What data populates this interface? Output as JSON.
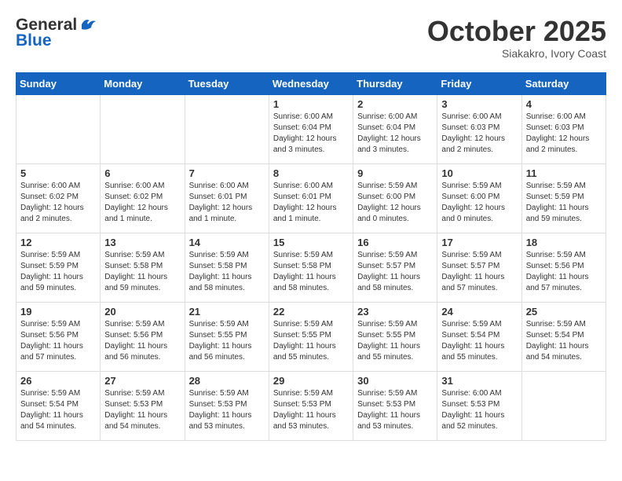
{
  "header": {
    "logo_general": "General",
    "logo_blue": "Blue",
    "month": "October 2025",
    "location": "Siakakro, Ivory Coast"
  },
  "days_of_week": [
    "Sunday",
    "Monday",
    "Tuesday",
    "Wednesday",
    "Thursday",
    "Friday",
    "Saturday"
  ],
  "weeks": [
    [
      {
        "day": "",
        "sunrise": "",
        "sunset": "",
        "daylight": ""
      },
      {
        "day": "",
        "sunrise": "",
        "sunset": "",
        "daylight": ""
      },
      {
        "day": "",
        "sunrise": "",
        "sunset": "",
        "daylight": ""
      },
      {
        "day": "1",
        "sunrise": "Sunrise: 6:00 AM",
        "sunset": "Sunset: 6:04 PM",
        "daylight": "Daylight: 12 hours and 3 minutes."
      },
      {
        "day": "2",
        "sunrise": "Sunrise: 6:00 AM",
        "sunset": "Sunset: 6:04 PM",
        "daylight": "Daylight: 12 hours and 3 minutes."
      },
      {
        "day": "3",
        "sunrise": "Sunrise: 6:00 AM",
        "sunset": "Sunset: 6:03 PM",
        "daylight": "Daylight: 12 hours and 2 minutes."
      },
      {
        "day": "4",
        "sunrise": "Sunrise: 6:00 AM",
        "sunset": "Sunset: 6:03 PM",
        "daylight": "Daylight: 12 hours and 2 minutes."
      }
    ],
    [
      {
        "day": "5",
        "sunrise": "Sunrise: 6:00 AM",
        "sunset": "Sunset: 6:02 PM",
        "daylight": "Daylight: 12 hours and 2 minutes."
      },
      {
        "day": "6",
        "sunrise": "Sunrise: 6:00 AM",
        "sunset": "Sunset: 6:02 PM",
        "daylight": "Daylight: 12 hours and 1 minute."
      },
      {
        "day": "7",
        "sunrise": "Sunrise: 6:00 AM",
        "sunset": "Sunset: 6:01 PM",
        "daylight": "Daylight: 12 hours and 1 minute."
      },
      {
        "day": "8",
        "sunrise": "Sunrise: 6:00 AM",
        "sunset": "Sunset: 6:01 PM",
        "daylight": "Daylight: 12 hours and 1 minute."
      },
      {
        "day": "9",
        "sunrise": "Sunrise: 5:59 AM",
        "sunset": "Sunset: 6:00 PM",
        "daylight": "Daylight: 12 hours and 0 minutes."
      },
      {
        "day": "10",
        "sunrise": "Sunrise: 5:59 AM",
        "sunset": "Sunset: 6:00 PM",
        "daylight": "Daylight: 12 hours and 0 minutes."
      },
      {
        "day": "11",
        "sunrise": "Sunrise: 5:59 AM",
        "sunset": "Sunset: 5:59 PM",
        "daylight": "Daylight: 11 hours and 59 minutes."
      }
    ],
    [
      {
        "day": "12",
        "sunrise": "Sunrise: 5:59 AM",
        "sunset": "Sunset: 5:59 PM",
        "daylight": "Daylight: 11 hours and 59 minutes."
      },
      {
        "day": "13",
        "sunrise": "Sunrise: 5:59 AM",
        "sunset": "Sunset: 5:58 PM",
        "daylight": "Daylight: 11 hours and 59 minutes."
      },
      {
        "day": "14",
        "sunrise": "Sunrise: 5:59 AM",
        "sunset": "Sunset: 5:58 PM",
        "daylight": "Daylight: 11 hours and 58 minutes."
      },
      {
        "day": "15",
        "sunrise": "Sunrise: 5:59 AM",
        "sunset": "Sunset: 5:58 PM",
        "daylight": "Daylight: 11 hours and 58 minutes."
      },
      {
        "day": "16",
        "sunrise": "Sunrise: 5:59 AM",
        "sunset": "Sunset: 5:57 PM",
        "daylight": "Daylight: 11 hours and 58 minutes."
      },
      {
        "day": "17",
        "sunrise": "Sunrise: 5:59 AM",
        "sunset": "Sunset: 5:57 PM",
        "daylight": "Daylight: 11 hours and 57 minutes."
      },
      {
        "day": "18",
        "sunrise": "Sunrise: 5:59 AM",
        "sunset": "Sunset: 5:56 PM",
        "daylight": "Daylight: 11 hours and 57 minutes."
      }
    ],
    [
      {
        "day": "19",
        "sunrise": "Sunrise: 5:59 AM",
        "sunset": "Sunset: 5:56 PM",
        "daylight": "Daylight: 11 hours and 57 minutes."
      },
      {
        "day": "20",
        "sunrise": "Sunrise: 5:59 AM",
        "sunset": "Sunset: 5:56 PM",
        "daylight": "Daylight: 11 hours and 56 minutes."
      },
      {
        "day": "21",
        "sunrise": "Sunrise: 5:59 AM",
        "sunset": "Sunset: 5:55 PM",
        "daylight": "Daylight: 11 hours and 56 minutes."
      },
      {
        "day": "22",
        "sunrise": "Sunrise: 5:59 AM",
        "sunset": "Sunset: 5:55 PM",
        "daylight": "Daylight: 11 hours and 55 minutes."
      },
      {
        "day": "23",
        "sunrise": "Sunrise: 5:59 AM",
        "sunset": "Sunset: 5:55 PM",
        "daylight": "Daylight: 11 hours and 55 minutes."
      },
      {
        "day": "24",
        "sunrise": "Sunrise: 5:59 AM",
        "sunset": "Sunset: 5:54 PM",
        "daylight": "Daylight: 11 hours and 55 minutes."
      },
      {
        "day": "25",
        "sunrise": "Sunrise: 5:59 AM",
        "sunset": "Sunset: 5:54 PM",
        "daylight": "Daylight: 11 hours and 54 minutes."
      }
    ],
    [
      {
        "day": "26",
        "sunrise": "Sunrise: 5:59 AM",
        "sunset": "Sunset: 5:54 PM",
        "daylight": "Daylight: 11 hours and 54 minutes."
      },
      {
        "day": "27",
        "sunrise": "Sunrise: 5:59 AM",
        "sunset": "Sunset: 5:53 PM",
        "daylight": "Daylight: 11 hours and 54 minutes."
      },
      {
        "day": "28",
        "sunrise": "Sunrise: 5:59 AM",
        "sunset": "Sunset: 5:53 PM",
        "daylight": "Daylight: 11 hours and 53 minutes."
      },
      {
        "day": "29",
        "sunrise": "Sunrise: 5:59 AM",
        "sunset": "Sunset: 5:53 PM",
        "daylight": "Daylight: 11 hours and 53 minutes."
      },
      {
        "day": "30",
        "sunrise": "Sunrise: 5:59 AM",
        "sunset": "Sunset: 5:53 PM",
        "daylight": "Daylight: 11 hours and 53 minutes."
      },
      {
        "day": "31",
        "sunrise": "Sunrise: 6:00 AM",
        "sunset": "Sunset: 5:53 PM",
        "daylight": "Daylight: 11 hours and 52 minutes."
      },
      {
        "day": "",
        "sunrise": "",
        "sunset": "",
        "daylight": ""
      }
    ]
  ]
}
